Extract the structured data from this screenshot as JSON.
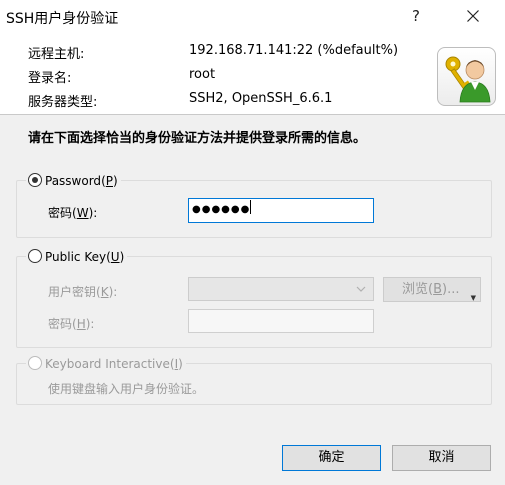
{
  "window": {
    "title": "SSH用户身份验证",
    "help_glyph": "?",
    "close_glyph": "✕"
  },
  "info": {
    "host_label": "远程主机:",
    "host_value": "192.168.71.141:22 (%default%)",
    "login_label": "登录名:",
    "login_value": "root",
    "server_type_label": "服务器类型:",
    "server_type_value": "SSH2, OpenSSH_6.6.1"
  },
  "instruction": "请在下面选择恰当的身份验证方法并提供登录所需的信息。",
  "password_group": {
    "radio_label": "Password",
    "radio_key": "P",
    "selected": true,
    "field_label": "密码",
    "field_key": "W",
    "masked_value": "●●●●●●"
  },
  "public_key_group": {
    "radio_label": "Public Key",
    "radio_key": "U",
    "selected": false,
    "user_key_label": "用户密钥",
    "user_key_key": "K",
    "browse_label": "浏览",
    "browse_key": "B",
    "browse_ellipsis": "...",
    "passphrase_label": "密码",
    "passphrase_key": "H"
  },
  "keyboard_group": {
    "radio_label": "Keyboard Interactive",
    "radio_key": "I",
    "description": "使用键盘输入用户身份验证。"
  },
  "buttons": {
    "ok": "确定",
    "cancel": "取消"
  }
}
